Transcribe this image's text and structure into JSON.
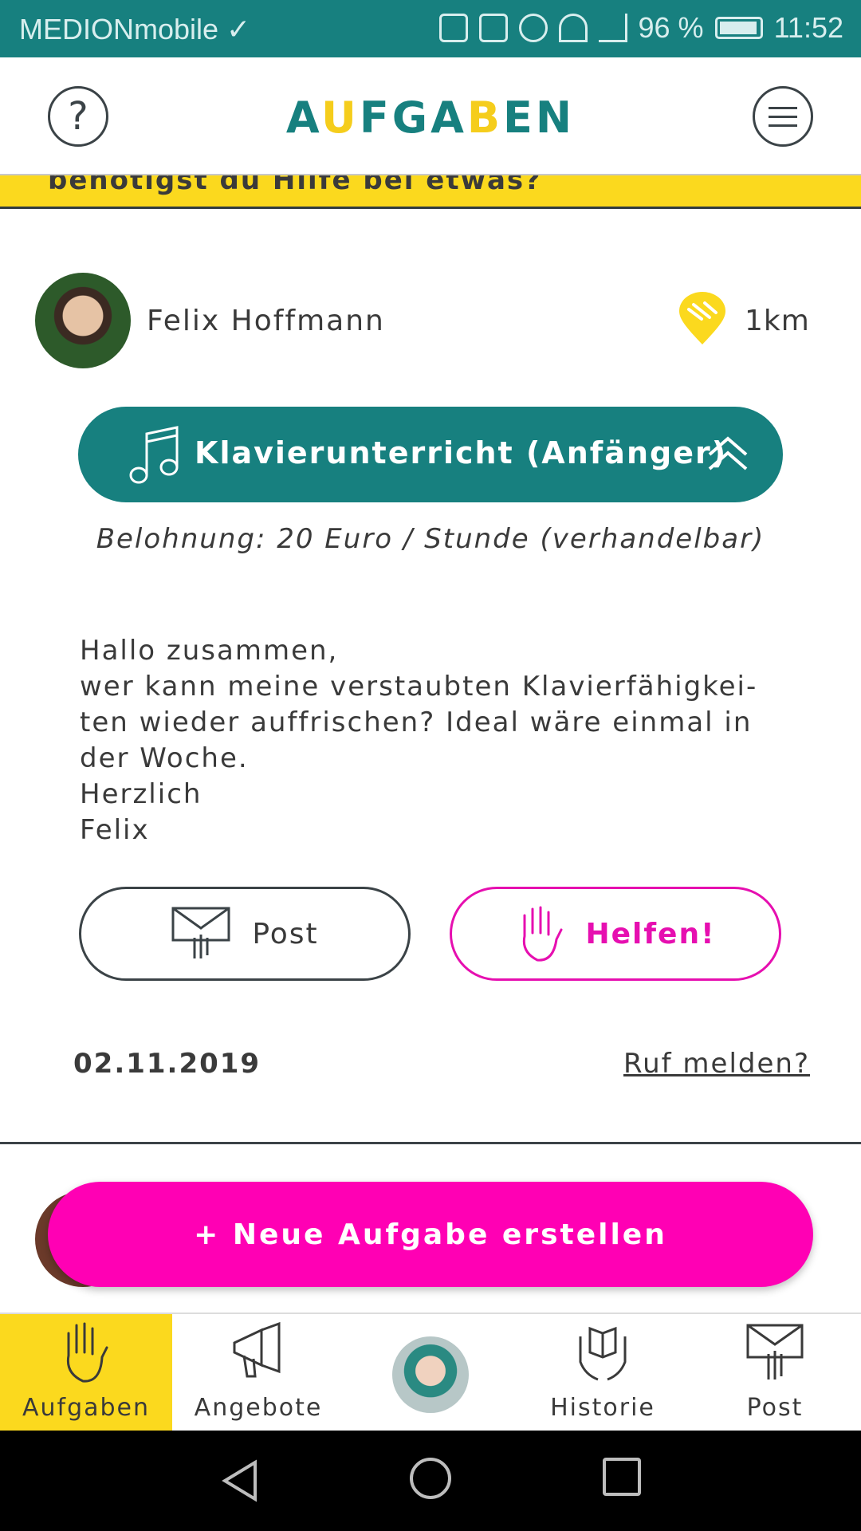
{
  "status_bar": {
    "carrier": "MEDIONmobile ✓",
    "battery": "96 %",
    "time": "11:52"
  },
  "header": {
    "title_parts": [
      "A",
      "U",
      "FGA",
      "B",
      "EN"
    ],
    "help_label": "?"
  },
  "banner": {
    "text": "benötigst du Hilfe bei etwas?"
  },
  "task": {
    "user_name": "Felix Hoffmann",
    "distance": "1km",
    "category": "Klavierunterricht (Anfänger)",
    "reward": "Belohnung: 20 Euro / Stunde (verhandelbar)",
    "message_lines": [
      "Hallo zusammen,",
      "wer kann meine verstaubten Klavierfähigkei-",
      "ten wieder auffrischen? Ideal wäre einmal in",
      "der Woche.",
      "Herzlich",
      "Felix"
    ],
    "post_button": "Post",
    "help_button": "Helfen!",
    "date": "02.11.2019",
    "report_link": "Ruf melden?"
  },
  "cta": {
    "label": "+ Neue Aufgabe erstellen"
  },
  "bottom_nav": {
    "items": [
      {
        "label": "Aufgaben",
        "icon": "hand-icon",
        "active": true
      },
      {
        "label": "Angebote",
        "icon": "megaphone-icon",
        "active": false
      },
      {
        "label": "",
        "icon": "profile-avatar",
        "active": false
      },
      {
        "label": "Historie",
        "icon": "hands-book-icon",
        "active": false
      },
      {
        "label": "Post",
        "icon": "mail-hand-icon",
        "active": false
      }
    ]
  },
  "colors": {
    "teal": "#17807f",
    "yellow": "#fbd91e",
    "magenta": "#ff00b4",
    "text": "#3a3a3a"
  }
}
